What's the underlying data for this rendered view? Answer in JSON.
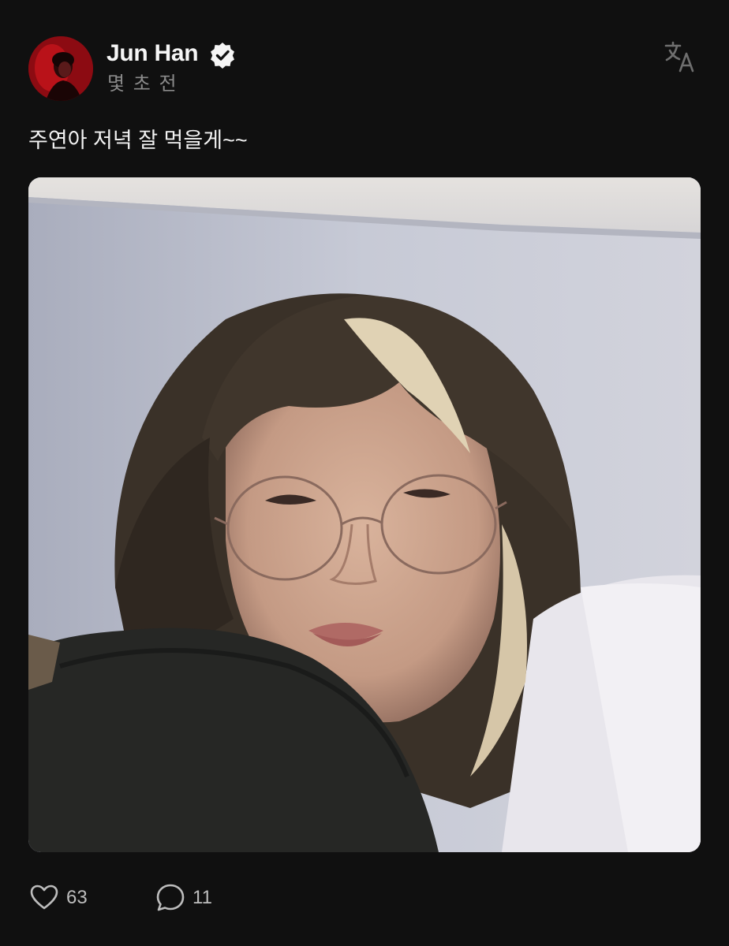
{
  "post": {
    "author": {
      "name": "Jun Han",
      "verified": true,
      "avatar_icon": "profile-photo-red"
    },
    "timestamp": "몇 초 전",
    "translate_icon": "translate-icon",
    "text": "주연아 저녁 잘 먹을게~~",
    "photo": {
      "description_icon": "selfie-photo"
    },
    "stats": {
      "likes": "63",
      "comments": "11"
    }
  },
  "colors": {
    "background": "#101010",
    "text": "#f2f2f2",
    "muted": "#8a8a8a",
    "icon": "#bdbdbd"
  }
}
